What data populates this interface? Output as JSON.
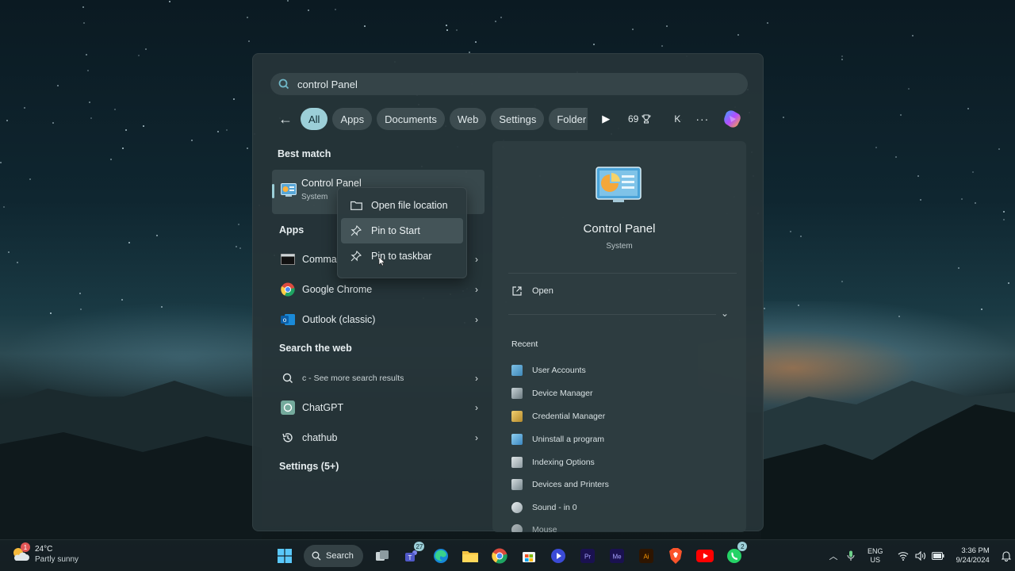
{
  "search": {
    "query": "control Panel"
  },
  "filters": {
    "back_label": "←",
    "chips": [
      "All",
      "Apps",
      "Documents",
      "Web",
      "Settings",
      "Folder"
    ],
    "points": "69",
    "account_initial": "K",
    "more_label": "···"
  },
  "results": {
    "best_match_heading": "Best match",
    "best_match": {
      "title": "Control Panel",
      "subtitle": "System"
    },
    "apps_heading": "Apps",
    "apps": [
      {
        "label": "Comma",
        "icon": "terminal-icon"
      },
      {
        "label": "Google Chrome",
        "icon": "chrome-icon"
      },
      {
        "label": "Outlook (classic)",
        "icon": "outlook-icon"
      }
    ],
    "web_heading": "Search the web",
    "web": [
      {
        "label": "c - See more search results",
        "icon": "search-icon"
      },
      {
        "label": "ChatGPT",
        "icon": "chatgpt-icon"
      },
      {
        "label": "chathub",
        "icon": "history-icon"
      }
    ],
    "settings_heading": "Settings (5+)"
  },
  "context_menu": {
    "items": [
      "Open file location",
      "Pin to Start",
      "Pin to taskbar"
    ]
  },
  "detail": {
    "title": "Control Panel",
    "subtitle": "System",
    "open_label": "Open",
    "recent_heading": "Recent",
    "recent": [
      "User Accounts",
      "Device Manager",
      "Credential Manager",
      "Uninstall a program",
      "Indexing Options",
      "Devices and Printers",
      "Sound - in 0",
      "Mouse"
    ]
  },
  "taskbar": {
    "weather_temp": "24°C",
    "weather_cond": "Partly sunny",
    "weather_badge": "1",
    "search_label": "Search",
    "teams_badge": "27",
    "whatsapp_badge": "2",
    "lang_top": "ENG",
    "lang_bottom": "US",
    "time": "3:36 PM",
    "date": "9/24/2024"
  },
  "colors": {
    "accent": "#9ccfd8",
    "panel": "#263438"
  }
}
